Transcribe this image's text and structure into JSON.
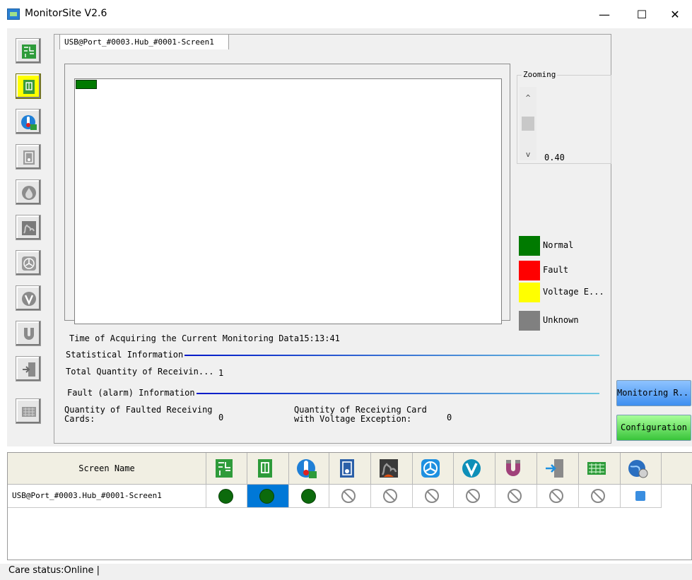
{
  "window": {
    "title": "MonitorSite V2.6",
    "minimize_label": "—",
    "maximize_label": "☐",
    "close_label": "✕"
  },
  "sidebar": {
    "items": [
      {
        "icon": "circuit-board-icon",
        "active": false
      },
      {
        "icon": "receiving-card-icon",
        "active": true
      },
      {
        "icon": "temperature-icon",
        "active": false
      },
      {
        "icon": "humidity-card-icon",
        "active": false
      },
      {
        "icon": "humidity-drop-icon",
        "active": false
      },
      {
        "icon": "smoke-icon",
        "active": false
      },
      {
        "icon": "fan-icon",
        "active": false
      },
      {
        "icon": "voltage-icon",
        "active": false
      },
      {
        "icon": "magnet-icon",
        "active": false
      },
      {
        "icon": "door-icon",
        "active": false
      },
      {
        "icon": "module-grid-icon",
        "active": false
      }
    ]
  },
  "tab": {
    "label": "USB@Port_#0003.Hub_#0001-Screen1"
  },
  "zoom": {
    "caption": "Zooming",
    "value": "0.40",
    "up_arrow": "^",
    "down_arrow": "v"
  },
  "legend": [
    {
      "label": "Normal",
      "color": "#007a00"
    },
    {
      "label": "Fault",
      "color": "#ff0000"
    },
    {
      "label": "Voltage E...",
      "color": "#ffff00"
    },
    {
      "label": "Unknown",
      "color": "#808080"
    }
  ],
  "monitoring": {
    "acquire_label": "Time of Acquiring the Current Monitoring Data",
    "acquire_time": "15:13:41"
  },
  "statistics": {
    "heading": "Statistical Information",
    "total_label": "Total Quantity of Receivin...",
    "total_value": "1"
  },
  "fault": {
    "heading": "Fault (alarm) Information",
    "faulted_label_1": "Quantity of Faulted Receiving",
    "faulted_label_2": "Cards:",
    "faulted_value": "0",
    "voltage_label_1": "Quantity of Receiving Card",
    "voltage_label_2": "with Voltage Exception:",
    "voltage_value": "0"
  },
  "buttons": {
    "monitoring": "Monitoring R...",
    "configuration": "Configuration"
  },
  "table": {
    "name_header": "Screen Name",
    "rows": [
      {
        "name": "USB@Port_#0003.Hub_#0001-Screen1",
        "status": [
          "ok",
          "ok",
          "ok",
          "na",
          "na",
          "na",
          "na",
          "na",
          "na",
          "na",
          "app"
        ]
      }
    ]
  },
  "status_bar": {
    "text": "Care status:Online  |"
  },
  "colors": {
    "normal": "#007a00",
    "fault": "#ff0000",
    "voltage": "#ffff00",
    "unknown": "#808080",
    "selected": "#0078d7"
  }
}
